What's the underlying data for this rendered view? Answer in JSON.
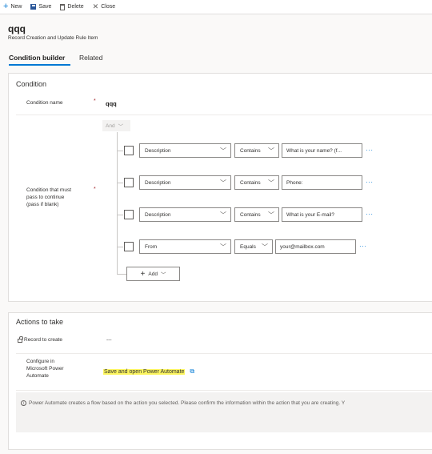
{
  "toolbar": {
    "new_label": "New",
    "save_label": "Save",
    "delete_label": "Delete",
    "close_label": "Close"
  },
  "record": {
    "title": "qqq",
    "subtitle": "Record Creation and Update Rule Item"
  },
  "tabs": [
    {
      "label": "Condition builder",
      "active": true
    },
    {
      "label": "Related",
      "active": false
    }
  ],
  "condition_section": {
    "title": "Condition",
    "name_label": "Condition name",
    "name_value": "qqq",
    "required_marker": "*",
    "logic_operator": "And",
    "must_pass_label_lines": [
      "Condition that must",
      "pass to continue",
      "(pass if blank)"
    ],
    "rows": [
      {
        "field": "Description",
        "operator": "Contains",
        "value": "What is your name? (f..."
      },
      {
        "field": "Description",
        "operator": "Contains",
        "value": "Phone:"
      },
      {
        "field": "Description",
        "operator": "Contains",
        "value": "What is your E-mail?"
      },
      {
        "field": "From",
        "operator": "Equals",
        "value": "your@mailbox.com"
      }
    ],
    "add_label": "Add",
    "more_glyph": "···"
  },
  "actions_section": {
    "title": "Actions to take",
    "record_to_create_label": "Record to create",
    "record_to_create_value": "---",
    "configure_label_lines": [
      "Configure in",
      "Microsoft Power",
      "Automate"
    ],
    "save_open_label": "Save and open Power Automate",
    "info_text": "Power Automate creates a flow based on the action you selected. Please confirm the information within the action that you are creating. Y"
  },
  "colors": {
    "accent": "#0078d4",
    "required": "#a4262c",
    "highlight": "#fcf55f"
  }
}
